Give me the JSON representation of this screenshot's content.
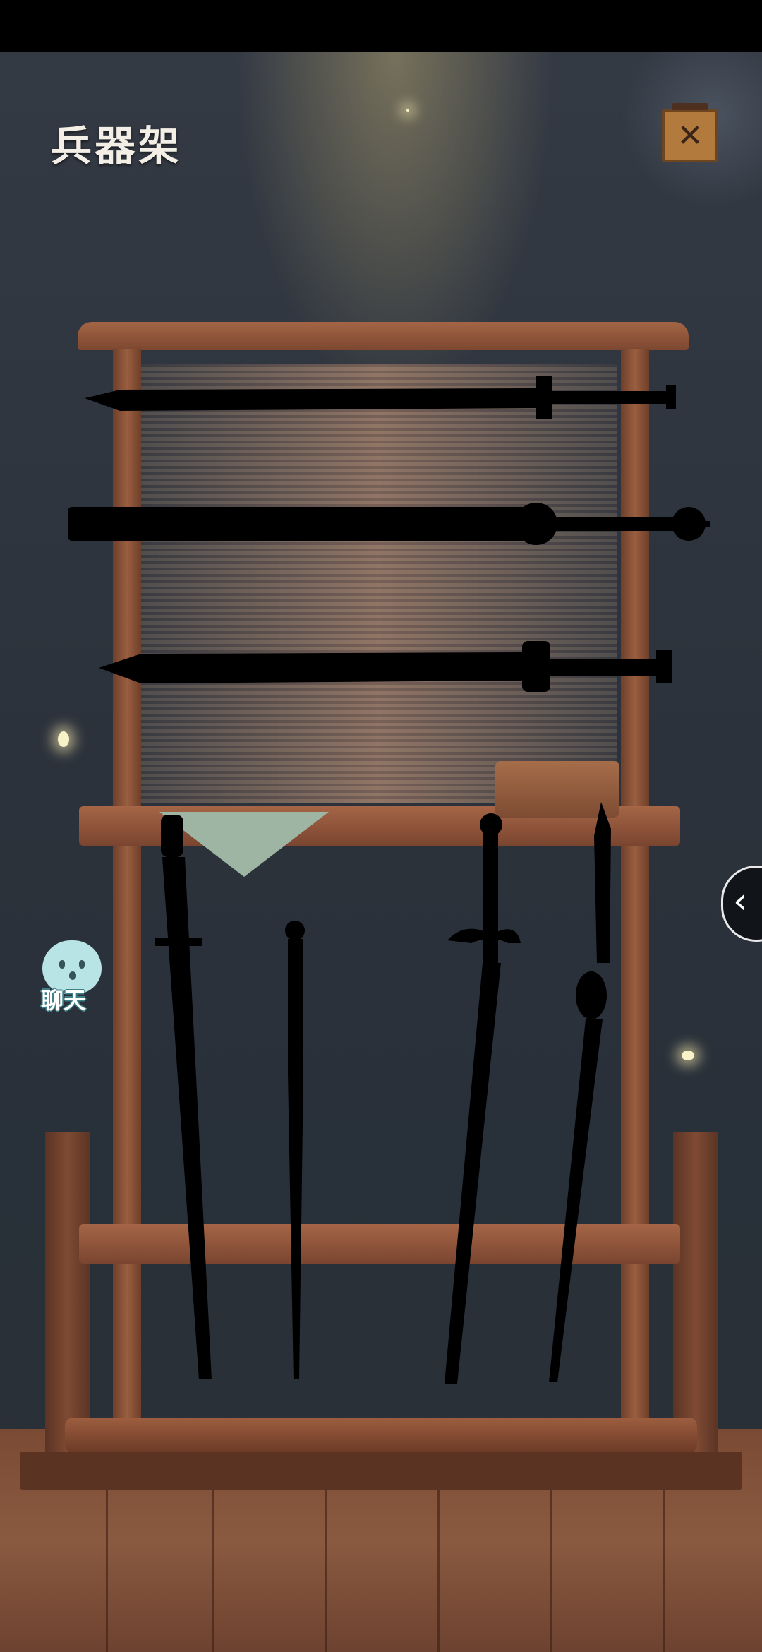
{
  "header": {
    "title": "兵器架",
    "close_icon": "close-x-icon"
  },
  "sidebar_toggle": {
    "icon": "chevron-left-icon",
    "glyph": "‹"
  },
  "chat": {
    "label": "聊天",
    "icon": "ghost-chat-icon"
  },
  "weapons": {
    "horizontal_count": 3,
    "vertical_count": 4,
    "names": []
  },
  "colors": {
    "wood": "#9a5e40",
    "silhouette": "#000000",
    "chat_text_outline": "#3f7f88"
  }
}
